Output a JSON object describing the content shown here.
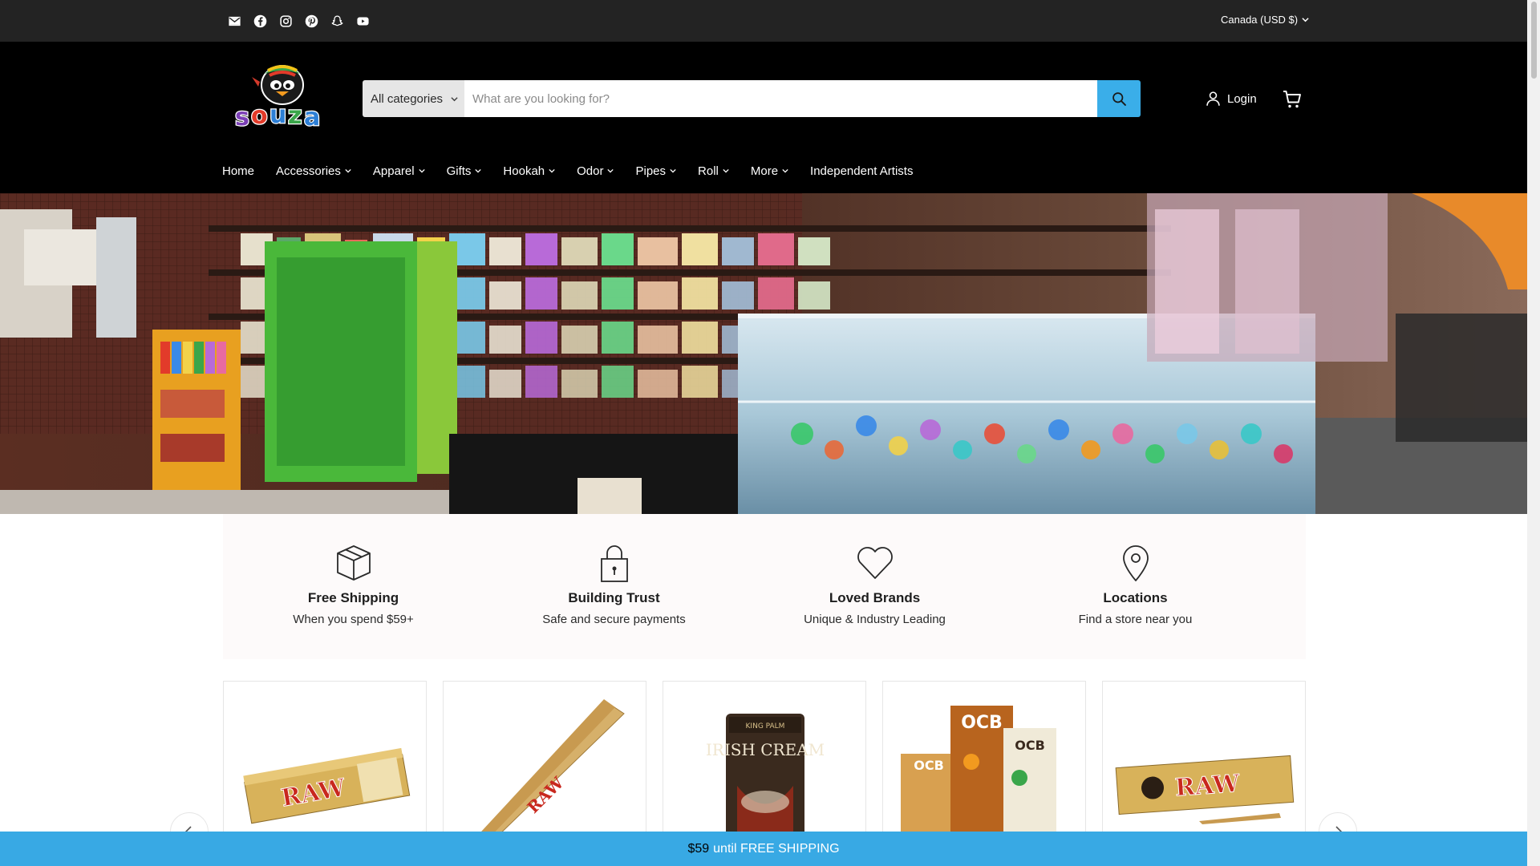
{
  "topbar": {
    "social_icons": [
      "email-icon",
      "facebook-icon",
      "instagram-icon",
      "pinterest-icon",
      "snapchat-icon",
      "youtube-icon"
    ],
    "currency": "Canada (USD $)"
  },
  "header": {
    "logo_text": "Souza",
    "search": {
      "category": "All categories",
      "placeholder": "What are you looking for?"
    },
    "login_label": "Login"
  },
  "nav": {
    "items": [
      {
        "label": "Home",
        "dropdown": false
      },
      {
        "label": "Accessories",
        "dropdown": true
      },
      {
        "label": "Apparel",
        "dropdown": true
      },
      {
        "label": "Gifts",
        "dropdown": true
      },
      {
        "label": "Hookah",
        "dropdown": true
      },
      {
        "label": "Odor",
        "dropdown": true
      },
      {
        "label": "Pipes",
        "dropdown": true
      },
      {
        "label": "Roll",
        "dropdown": true
      },
      {
        "label": "More",
        "dropdown": true
      },
      {
        "label": "Independent Artists",
        "dropdown": false
      }
    ]
  },
  "features": [
    {
      "icon": "box-icon",
      "title": "Free Shipping",
      "subtitle": "When you spend $59+"
    },
    {
      "icon": "lock-icon",
      "title": "Building Trust",
      "subtitle": "Safe and secure payments"
    },
    {
      "icon": "heart-icon",
      "title": "Loved Brands",
      "subtitle": "Unique & Industry Leading"
    },
    {
      "icon": "location-pin-icon",
      "title": "Locations",
      "subtitle": "Find a store near you"
    }
  ],
  "products": [
    {
      "name": "raw-cones-pack",
      "brand_text": "RAW"
    },
    {
      "name": "raw-cone-single",
      "brand_text": "RAW"
    },
    {
      "name": "king-palm-irish-cream",
      "brand_text": "KING PALM",
      "product_text": "IRISH CREAM"
    },
    {
      "name": "ocb-cones-boxes",
      "brand_text": "OCB"
    },
    {
      "name": "raw-lean-cones",
      "brand_text": "RAW"
    }
  ],
  "shipping_bar": {
    "amount": "$59",
    "message": "until FREE SHIPPING"
  },
  "colors": {
    "accent": "#3aaee9",
    "topbar": "#232323",
    "header": "#000000",
    "shipbar": "#38a9e4"
  }
}
